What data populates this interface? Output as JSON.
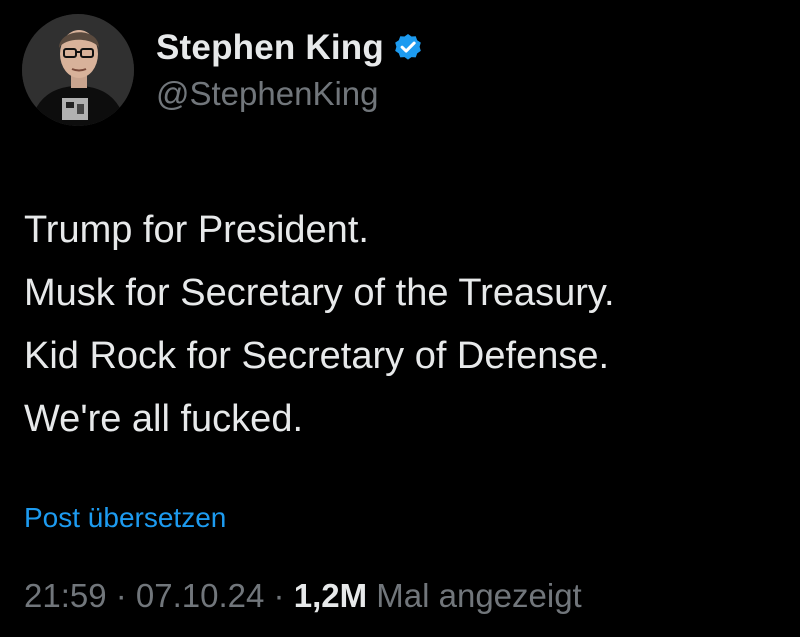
{
  "author": {
    "display_name": "Stephen King",
    "handle": "@StephenKing",
    "verified": true,
    "avatar_icon": "profile-photo",
    "verified_icon": "verified-badge-icon"
  },
  "post": {
    "lines": [
      "Trump for President.",
      "Musk for Secretary of the Treasury.",
      "Kid Rock for Secretary of Defense.",
      "We're all fucked."
    ],
    "translate_label": "Post übersetzen"
  },
  "meta": {
    "time": "21:59",
    "separator": " · ",
    "date": "07.10.24",
    "views_count": "1,2M",
    "views_label": "Mal angezeigt"
  },
  "colors": {
    "background": "#000000",
    "primary_text": "#e7e9ea",
    "secondary_text": "#71767b",
    "accent": "#1d9bf0"
  }
}
